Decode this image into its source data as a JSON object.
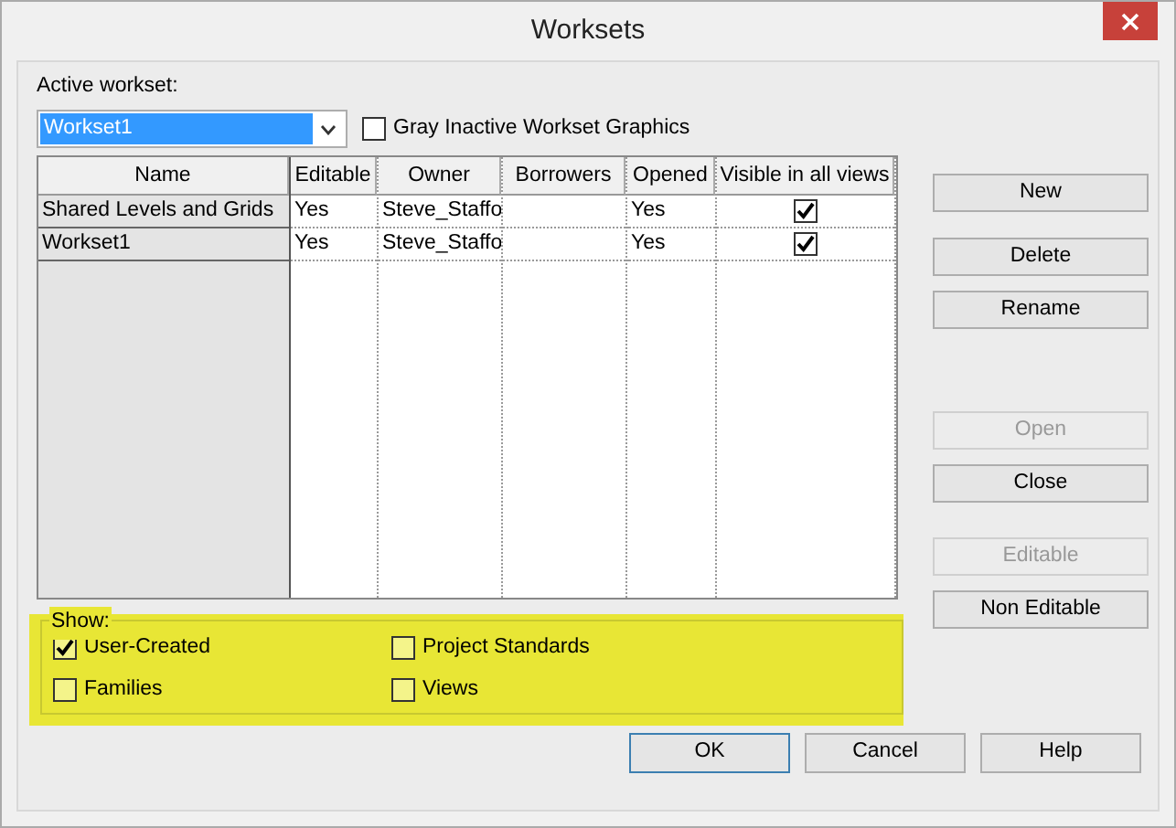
{
  "window": {
    "title": "Worksets"
  },
  "active_workset": {
    "label": "Active workset:",
    "value": "Workset1"
  },
  "gray_inactive": {
    "label": "Gray Inactive Workset Graphics",
    "checked": false
  },
  "table": {
    "columns": [
      "Name",
      "Editable",
      "Owner",
      "Borrowers",
      "Opened",
      "Visible in all views"
    ],
    "rows": [
      {
        "name": "Shared Levels and Grids",
        "editable": "Yes",
        "owner": "Steve_Staffo",
        "opened": "Yes",
        "visible_in_all_views": true
      },
      {
        "name": "Workset1",
        "editable": "Yes",
        "owner": "Steve_Staffo",
        "opened": "Yes",
        "visible_in_all_views": true
      }
    ]
  },
  "side_button_groups": [
    [
      {
        "label": "New",
        "disabled": false
      }
    ],
    [
      {
        "label": "Delete",
        "disabled": false
      },
      {
        "label": "Rename",
        "disabled": false
      }
    ],
    [
      {
        "label": "Open",
        "disabled": true
      },
      {
        "label": "Close",
        "disabled": false
      }
    ],
    [
      {
        "label": "Editable",
        "disabled": true
      },
      {
        "label": "Non Editable",
        "disabled": false
      }
    ]
  ],
  "show": {
    "label": "Show:",
    "options": [
      {
        "label": "User-Created",
        "checked": true
      },
      {
        "label": "Project Standards",
        "checked": false
      },
      {
        "label": "Families",
        "checked": false
      },
      {
        "label": "Views",
        "checked": false
      }
    ]
  },
  "dialog_buttons": [
    {
      "label": "OK",
      "default": true
    },
    {
      "label": "Cancel",
      "default": false
    },
    {
      "label": "Help",
      "default": false
    }
  ]
}
